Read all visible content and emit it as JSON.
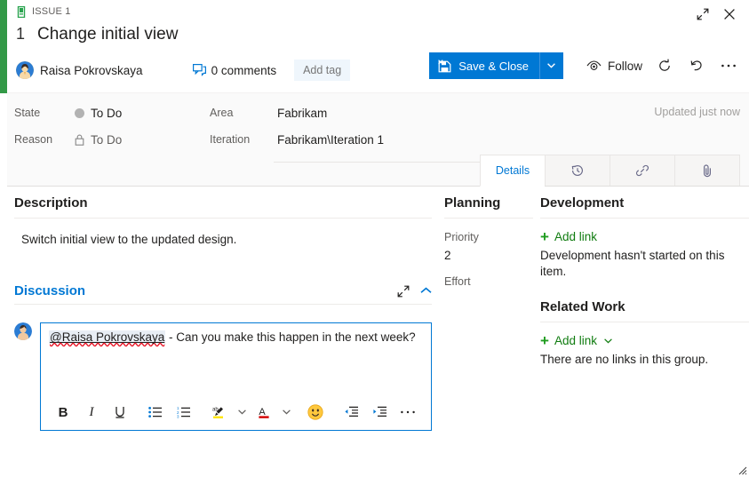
{
  "window": {
    "expand_label": "expand-icon",
    "close_label": "close-icon"
  },
  "header": {
    "breadcrumb": "ISSUE 1",
    "item_id": "1",
    "title": "Change initial view",
    "assignee": "Raisa Pokrovskaya",
    "comments": "0 comments",
    "add_tag": "Add tag",
    "save_label": "Save & Close",
    "follow_label": "Follow"
  },
  "fields": {
    "state_label": "State",
    "state_value": "To Do",
    "reason_label": "Reason",
    "reason_value": "To Do",
    "area_label": "Area",
    "area_value": "Fabrikam",
    "iteration_label": "Iteration",
    "iteration_value": "Fabrikam\\Iteration 1",
    "updated": "Updated just now"
  },
  "tabs": [
    {
      "label": "Details",
      "name": "tab-details",
      "active": true
    },
    {
      "label": "",
      "name": "tab-history",
      "active": false
    },
    {
      "label": "",
      "name": "tab-links",
      "active": false
    },
    {
      "label": "",
      "name": "tab-attachments",
      "active": false
    }
  ],
  "description": {
    "heading": "Description",
    "text": "Switch initial view to the updated design."
  },
  "discussion": {
    "heading": "Discussion",
    "mention": "@Raisa Pokrovskaya",
    "message": " - Can you make this happen in the next week?",
    "toolbar": [
      {
        "name": "bold-button",
        "label": "B"
      },
      {
        "name": "italic-button",
        "label": "I"
      },
      {
        "name": "underline-button",
        "label": "U"
      },
      {
        "name": "bulleted-list-button",
        "label": ""
      },
      {
        "name": "numbered-list-button",
        "label": ""
      },
      {
        "name": "highlight-button",
        "label": ""
      },
      {
        "name": "font-color-button",
        "label": ""
      },
      {
        "name": "emoji-button",
        "label": ""
      },
      {
        "name": "decrease-indent-button",
        "label": ""
      },
      {
        "name": "increase-indent-button",
        "label": ""
      },
      {
        "name": "more-options-button",
        "label": ""
      }
    ]
  },
  "planning": {
    "heading": "Planning",
    "priority_label": "Priority",
    "priority_value": "2",
    "effort_label": "Effort",
    "effort_value": ""
  },
  "development": {
    "heading": "Development",
    "add_link": "Add link",
    "empty_note": "Development hasn't started on this item."
  },
  "related_work": {
    "heading": "Related Work",
    "add_link": "Add link",
    "empty_note": "There are no links in this group."
  },
  "colors": {
    "type_bar": "#339947",
    "accent": "#0078d4",
    "link_green": "#107c10"
  }
}
